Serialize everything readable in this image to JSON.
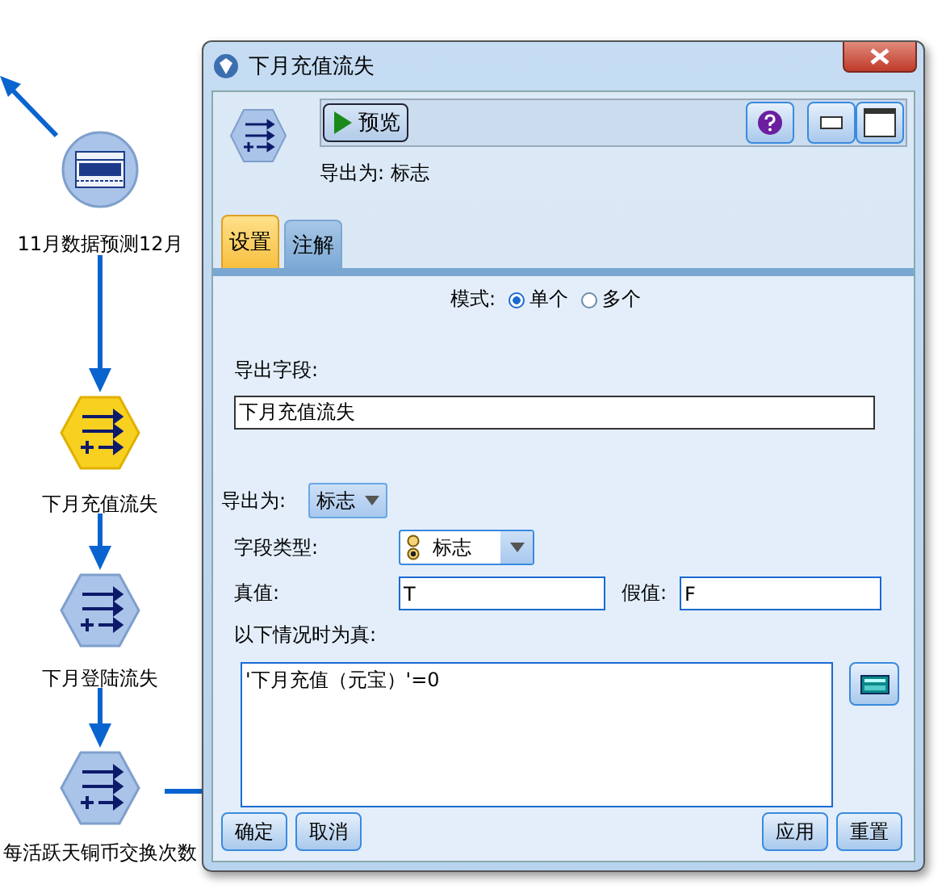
{
  "canvas": {
    "nodes": [
      {
        "label": "11月数据预测12月",
        "kind": "excel",
        "selected": false
      },
      {
        "label": "下月充值流失",
        "kind": "derive",
        "selected": true
      },
      {
        "label": "下月登陆流失",
        "kind": "derive",
        "selected": false
      },
      {
        "label": "每活跃天铜币交换次数",
        "kind": "derive",
        "selected": false
      }
    ]
  },
  "dialog": {
    "title": "下月充值流失",
    "preview_button": "预览",
    "derive_summary": "导出为: 标志",
    "tabs": [
      {
        "label": "设置",
        "selected": true
      },
      {
        "label": "注解",
        "selected": false
      }
    ],
    "mode": {
      "label": "模式:",
      "options": [
        {
          "label": "单个",
          "selected": true
        },
        {
          "label": "多个",
          "selected": false
        }
      ]
    },
    "derive_field": {
      "label": "导出字段:",
      "value": "下月充值流失"
    },
    "derive_as": {
      "label": "导出为:",
      "value": "标志"
    },
    "field_type": {
      "label": "字段类型:",
      "value": "标志"
    },
    "true_value": {
      "label": "真值:",
      "value": "T"
    },
    "false_value": {
      "label": "假值:",
      "value": "F"
    },
    "condition": {
      "label": "以下情况时为真:",
      "value": "'下月充值（元宝）'=0"
    },
    "buttons_left": [
      "确定",
      "取消"
    ],
    "buttons_right": [
      "应用",
      "重置"
    ]
  }
}
